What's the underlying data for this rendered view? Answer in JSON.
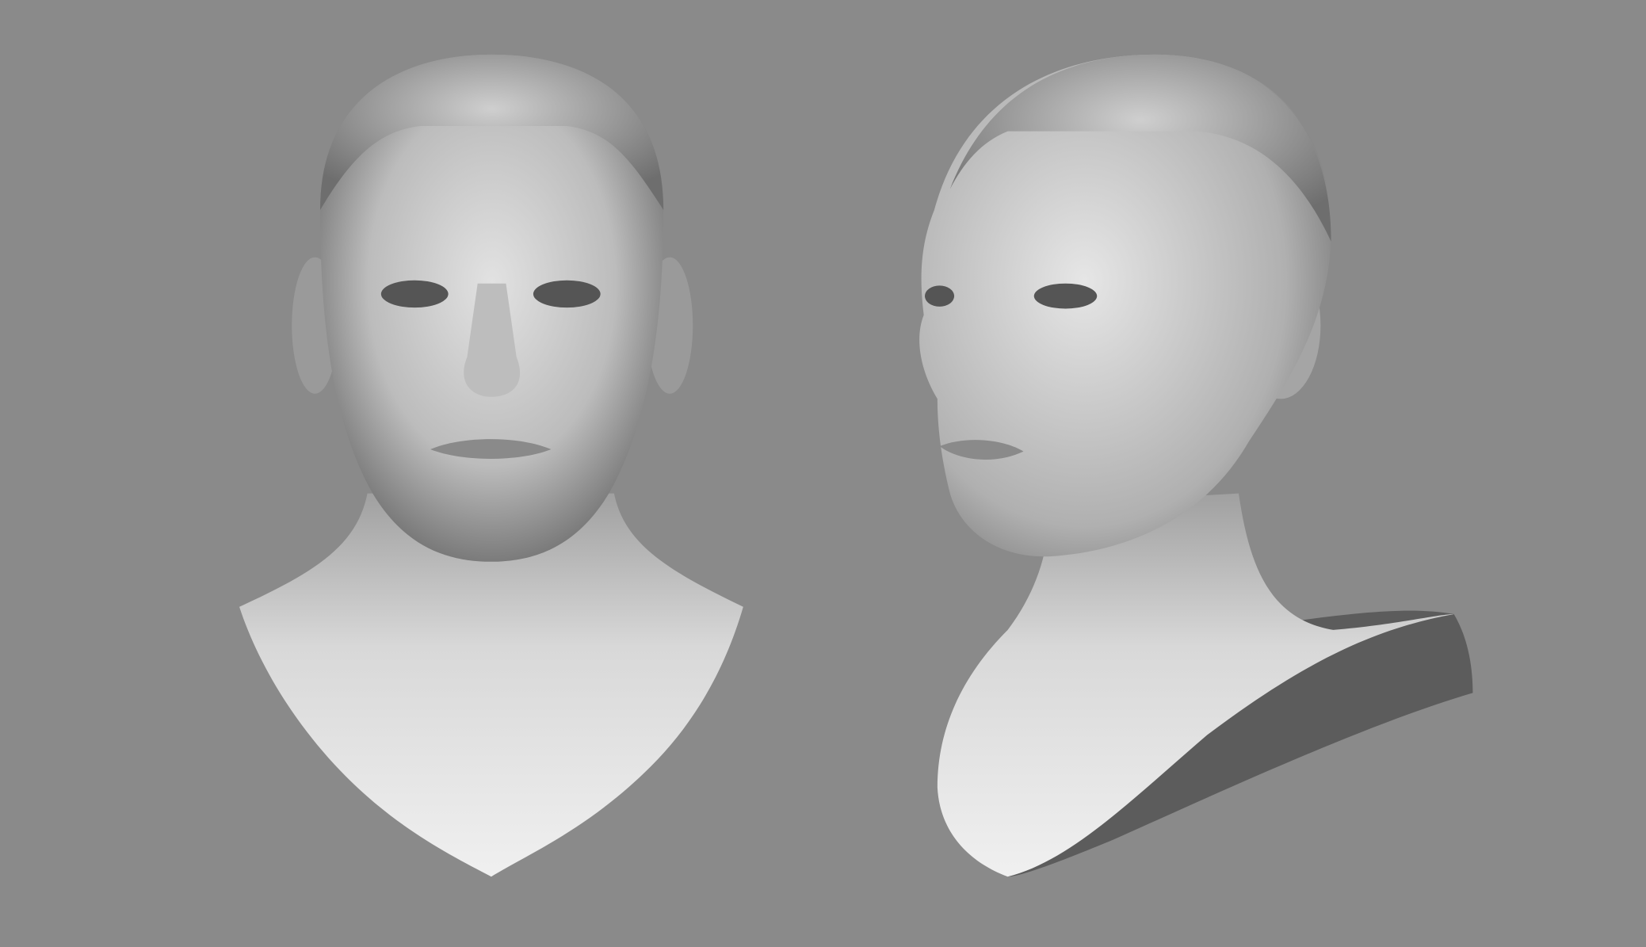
{
  "colors": {
    "background": "#8a8a8a",
    "skin_light": "#e4e4e4",
    "skin_mid": "#a9a9a9",
    "skin_dark": "#4a4a4a"
  }
}
